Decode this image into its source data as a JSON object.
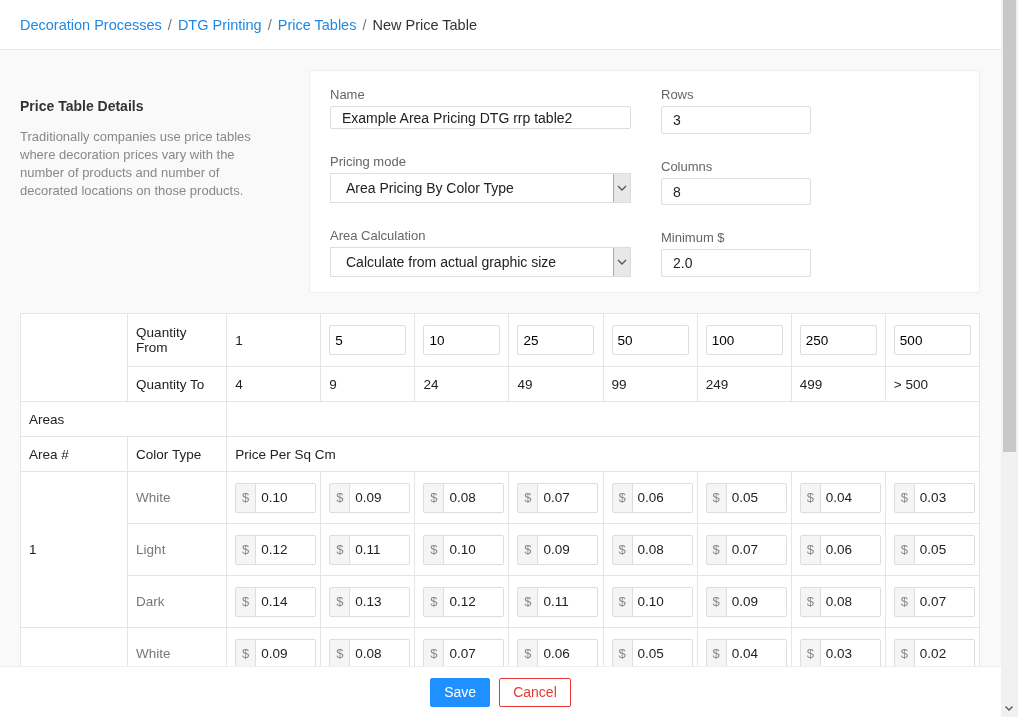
{
  "breadcrumb": [
    {
      "label": "Decoration Processes",
      "current": false
    },
    {
      "label": "DTG Printing",
      "current": false
    },
    {
      "label": "Price Tables",
      "current": false
    },
    {
      "label": "New Price Table",
      "current": true
    }
  ],
  "breadcrumb_separator": "/",
  "details": {
    "title": "Price Table Details",
    "description": "Traditionally companies use price tables where decoration prices vary with the number of products and number of decorated locations on those products."
  },
  "form": {
    "name": {
      "label": "Name",
      "value": "Example Area Pricing DTG rrp table2"
    },
    "rows": {
      "label": "Rows",
      "value": "3"
    },
    "pricing_mode": {
      "label": "Pricing mode",
      "value": "Area Pricing By Color Type"
    },
    "columns": {
      "label": "Columns",
      "value": "8"
    },
    "area_calculation": {
      "label": "Area Calculation",
      "value": "Calculate from actual graphic size"
    },
    "minimum": {
      "label": "Minimum $",
      "value": "2.0"
    }
  },
  "table": {
    "quantity_from_label": "Quantity From",
    "quantity_to_label": "Quantity To",
    "quantity_from": [
      {
        "kind": "text",
        "value": "1"
      },
      {
        "kind": "input",
        "value": "5"
      },
      {
        "kind": "input",
        "value": "10"
      },
      {
        "kind": "input",
        "value": "25"
      },
      {
        "kind": "input",
        "value": "50"
      },
      {
        "kind": "input",
        "value": "100"
      },
      {
        "kind": "input",
        "value": "250"
      },
      {
        "kind": "input",
        "value": "500"
      }
    ],
    "quantity_to": [
      "4",
      "9",
      "24",
      "49",
      "99",
      "249",
      "499",
      "> 500"
    ],
    "areas_label": "Areas",
    "area_number_label": "Area #",
    "color_type_label": "Color Type",
    "price_label": "Price Per Sq Cm",
    "currency": "$",
    "areas": [
      {
        "number": "1",
        "rows": [
          {
            "color_type": "White",
            "prices": [
              "0.10",
              "0.09",
              "0.08",
              "0.07",
              "0.06",
              "0.05",
              "0.04",
              "0.03"
            ]
          },
          {
            "color_type": "Light",
            "prices": [
              "0.12",
              "0.11",
              "0.10",
              "0.09",
              "0.08",
              "0.07",
              "0.06",
              "0.05"
            ]
          },
          {
            "color_type": "Dark",
            "prices": [
              "0.14",
              "0.13",
              "0.12",
              "0.11",
              "0.10",
              "0.09",
              "0.08",
              "0.07"
            ]
          }
        ]
      },
      {
        "rows": [
          {
            "color_type": "White",
            "prices": [
              "0.09",
              "0.08",
              "0.07",
              "0.06",
              "0.05",
              "0.04",
              "0.03",
              "0.02"
            ]
          }
        ]
      }
    ]
  },
  "footer": {
    "save": "Save",
    "cancel": "Cancel"
  }
}
